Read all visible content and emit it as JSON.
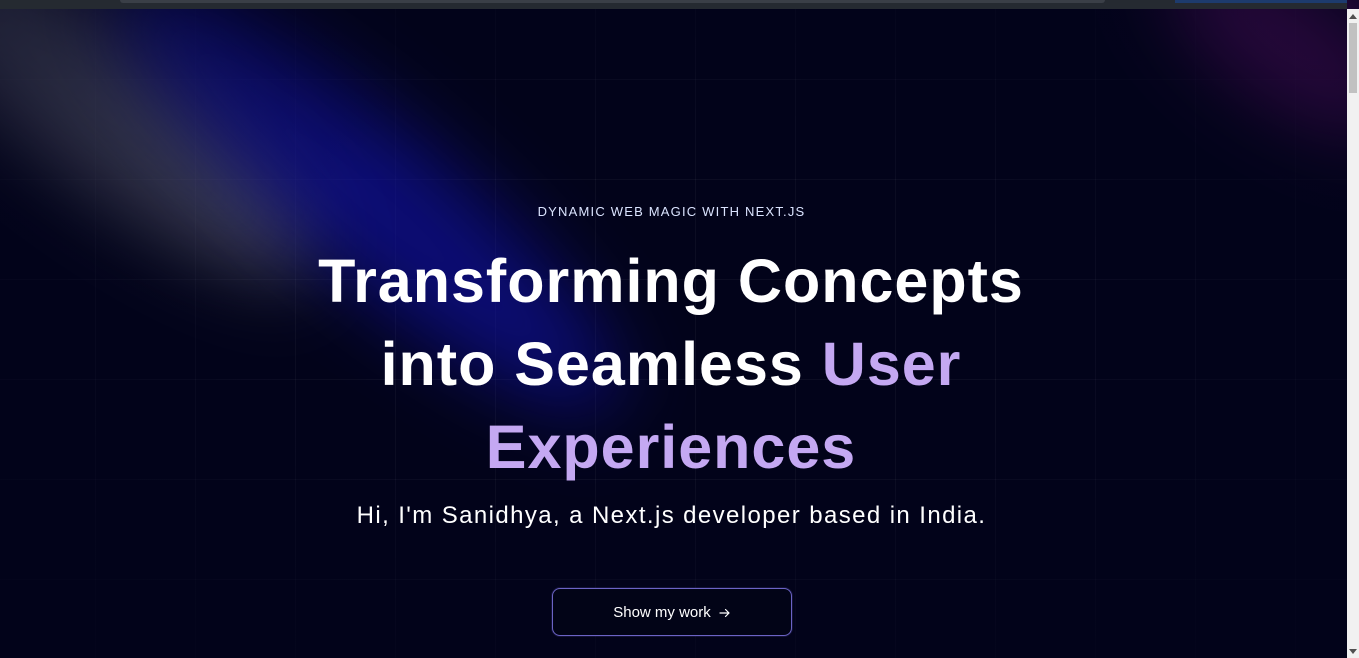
{
  "hero": {
    "eyebrow": "DYNAMIC WEB MAGIC WITH NEXT.JS",
    "headline_line1": "Transforming Concepts",
    "headline_line2_plain": "into Seamless",
    "headline_line2_accent": "User",
    "headline_line3_accent": "Experiences",
    "subline": "Hi, I'm Sanidhya, a Next.js developer based in India.",
    "cta_label": "Show my work",
    "cta_icon": "arrow-right-icon"
  },
  "colors": {
    "background": "#02031a",
    "accent_text": "#c4a8f2",
    "cta_border": "#6b63c4",
    "spot_blue": "#1414be",
    "spot_purple": "#82148c"
  }
}
